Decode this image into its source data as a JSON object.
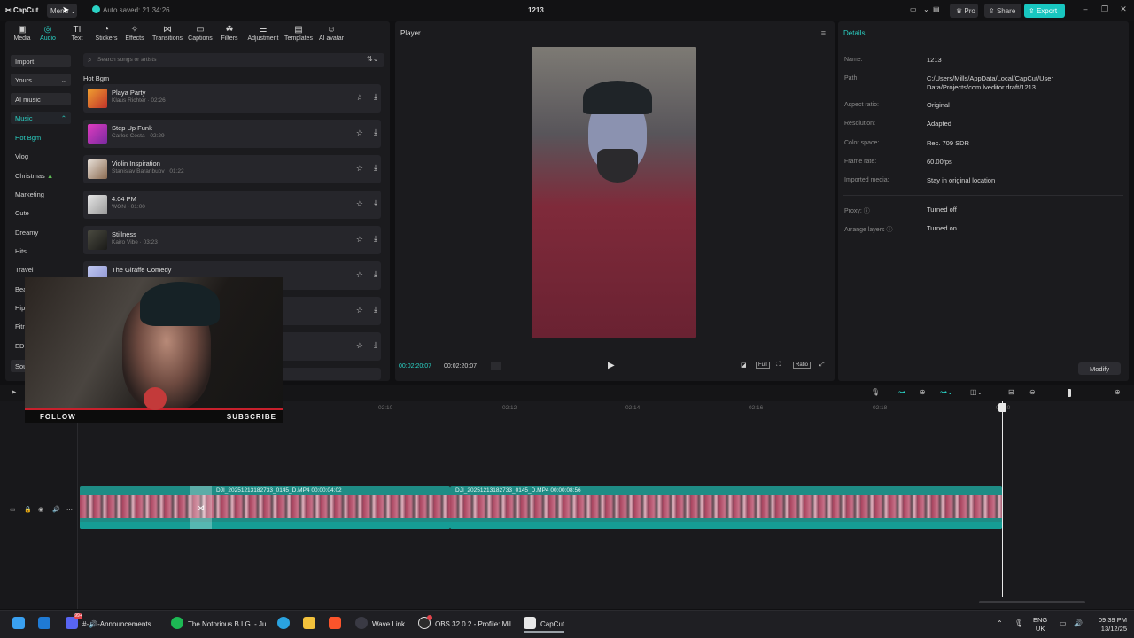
{
  "titlebar": {
    "app_name": "CapCut",
    "menu_label": "Menu",
    "autosave": "Auto saved: 21:34:26",
    "project_title": "1213",
    "pro_label": "Pro",
    "share_label": "Share",
    "export_label": "Export",
    "accent_color": "#18c6c0"
  },
  "toolbar": {
    "tabs": [
      {
        "label": "Media",
        "icon": "media-icon"
      },
      {
        "label": "Audio",
        "icon": "audio-icon"
      },
      {
        "label": "Text",
        "icon": "text-icon"
      },
      {
        "label": "Stickers",
        "icon": "stickers-icon"
      },
      {
        "label": "Effects",
        "icon": "effects-icon"
      },
      {
        "label": "Transitions",
        "icon": "transitions-icon"
      },
      {
        "label": "Captions",
        "icon": "captions-icon"
      },
      {
        "label": "Filters",
        "icon": "filters-icon"
      },
      {
        "label": "Adjustment",
        "icon": "adjustment-icon"
      },
      {
        "label": "Templates",
        "icon": "templates-icon"
      },
      {
        "label": "AI avatar",
        "icon": "ai-avatar-icon"
      }
    ],
    "active": "Audio"
  },
  "categories": {
    "import": "Import",
    "yours": "Yours",
    "ai_music": "AI music",
    "music": "Music",
    "sub": [
      "Hot Bgm",
      "Vlog",
      "Christmas",
      "Marketing",
      "Cute",
      "Dreamy",
      "Hits",
      "Travel",
      "Bea",
      "Hip",
      "Fitn",
      "EDM",
      "Sou"
    ]
  },
  "search": {
    "placeholder": "Search songs or artists"
  },
  "music_list": {
    "section_title": "Hot Bgm",
    "tracks": [
      {
        "name": "Playa Party",
        "meta": "Klaus Richter · 02:26"
      },
      {
        "name": "Step Up Funk",
        "meta": "Carlos Costa · 02:29"
      },
      {
        "name": "Violin Inspiration",
        "meta": "Stanislav Baranbuov · 01:22"
      },
      {
        "name": "4:04 PM",
        "meta": "WON · 01:00"
      },
      {
        "name": "Stillness",
        "meta": "Kairo Vibe · 03:23"
      },
      {
        "name": "The Giraffe Comedy",
        "meta": ""
      }
    ]
  },
  "player": {
    "label": "Player",
    "current_time": "00:02:20:07",
    "total_time": "00:02:20:07",
    "full_label": "Full",
    "ratio_label": "Ratio"
  },
  "details": {
    "title": "Details",
    "rows": [
      {
        "label": "Name:",
        "value": "1213"
      },
      {
        "label": "Path:",
        "value": "C:/Users/Mills/AppData/Local/CapCut/User Data/Projects/com.lveditor.draft/1213"
      },
      {
        "label": "Aspect ratio:",
        "value": "Original"
      },
      {
        "label": "Resolution:",
        "value": "Adapted"
      },
      {
        "label": "Color space:",
        "value": "Rec. 709 SDR"
      },
      {
        "label": "Frame rate:",
        "value": "60.00fps"
      },
      {
        "label": "Imported media:",
        "value": "Stay in original location"
      },
      {
        "label": "Proxy:",
        "value": "Turned off"
      },
      {
        "label": "Arrange layers",
        "value": "Turned on"
      }
    ],
    "modify_label": "Modify"
  },
  "timeline": {
    "ruler": [
      "02:10",
      "02:12",
      "02:14",
      "02:16",
      "02:18",
      "02:20"
    ],
    "clips": [
      {
        "title": "DJI_20251213182733_0145_D.MP4   00:00:04:02"
      },
      {
        "title": "DJI_20251213182733_0145_D.MP4   00:00:08:56"
      }
    ]
  },
  "webcam": {
    "follow": "FOLLOW",
    "subscribe": "SUBSCRIBE"
  },
  "taskbar": {
    "apps": [
      {
        "label": "",
        "icon": "windows-start-icon"
      },
      {
        "label": "",
        "icon": "outlook-icon"
      },
      {
        "label": "#-🔊-Announcements",
        "icon": "discord-icon",
        "badge": "99+"
      },
      {
        "label": "The Notorious B.I.G. - Ju",
        "icon": "spotify-icon"
      },
      {
        "label": "",
        "icon": "telegram-icon"
      },
      {
        "label": "",
        "icon": "file-explorer-icon"
      },
      {
        "label": "",
        "icon": "brave-icon"
      },
      {
        "label": "Wave Link",
        "icon": "wave-link-icon"
      },
      {
        "label": "OBS 32.0.2 - Profile: Mil",
        "icon": "obs-icon"
      },
      {
        "label": "CapCut",
        "icon": "capcut-icon"
      }
    ],
    "lang": "ENG",
    "region": "UK",
    "time": "09:39 PM",
    "date": "13/12/25"
  }
}
